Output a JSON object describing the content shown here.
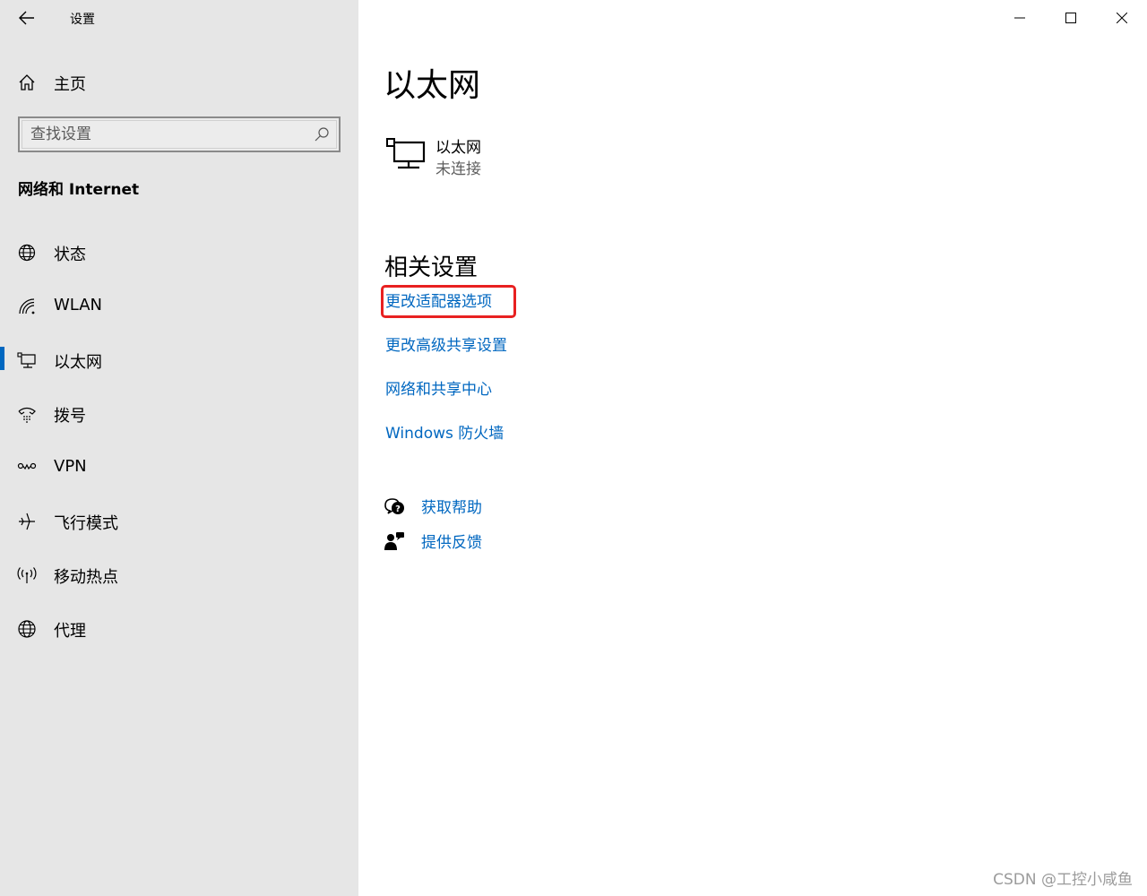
{
  "app": {
    "title": "设置"
  },
  "sidebar": {
    "home_label": "主页",
    "search_placeholder": "查找设置",
    "section_title": "网络和 Internet",
    "items": [
      {
        "label": "状态",
        "icon": "globe-status-icon",
        "active": false
      },
      {
        "label": "WLAN",
        "icon": "wifi-icon",
        "active": false
      },
      {
        "label": "以太网",
        "icon": "ethernet-icon",
        "active": true
      },
      {
        "label": "拨号",
        "icon": "dialup-icon",
        "active": false
      },
      {
        "label": "VPN",
        "icon": "vpn-icon",
        "active": false
      },
      {
        "label": "飞行模式",
        "icon": "airplane-icon",
        "active": false
      },
      {
        "label": "移动热点",
        "icon": "hotspot-icon",
        "active": false
      },
      {
        "label": "代理",
        "icon": "globe-icon",
        "active": false
      }
    ]
  },
  "main": {
    "title": "以太网",
    "ethernet": {
      "name": "以太网",
      "status": "未连接"
    },
    "related_title": "相关设置",
    "links": [
      {
        "label": "更改适配器选项",
        "highlighted": true
      },
      {
        "label": "更改高级共享设置"
      },
      {
        "label": "网络和共享中心"
      },
      {
        "label": "Windows 防火墙"
      }
    ],
    "help": [
      {
        "label": "获取帮助",
        "icon": "help-chat-icon"
      },
      {
        "label": "提供反馈",
        "icon": "feedback-icon"
      }
    ]
  },
  "watermark": "CSDN @工控小咸鱼",
  "colors": {
    "accent": "#0067c0",
    "sidebar_bg": "#e6e6e6",
    "highlight": "#e82121"
  }
}
